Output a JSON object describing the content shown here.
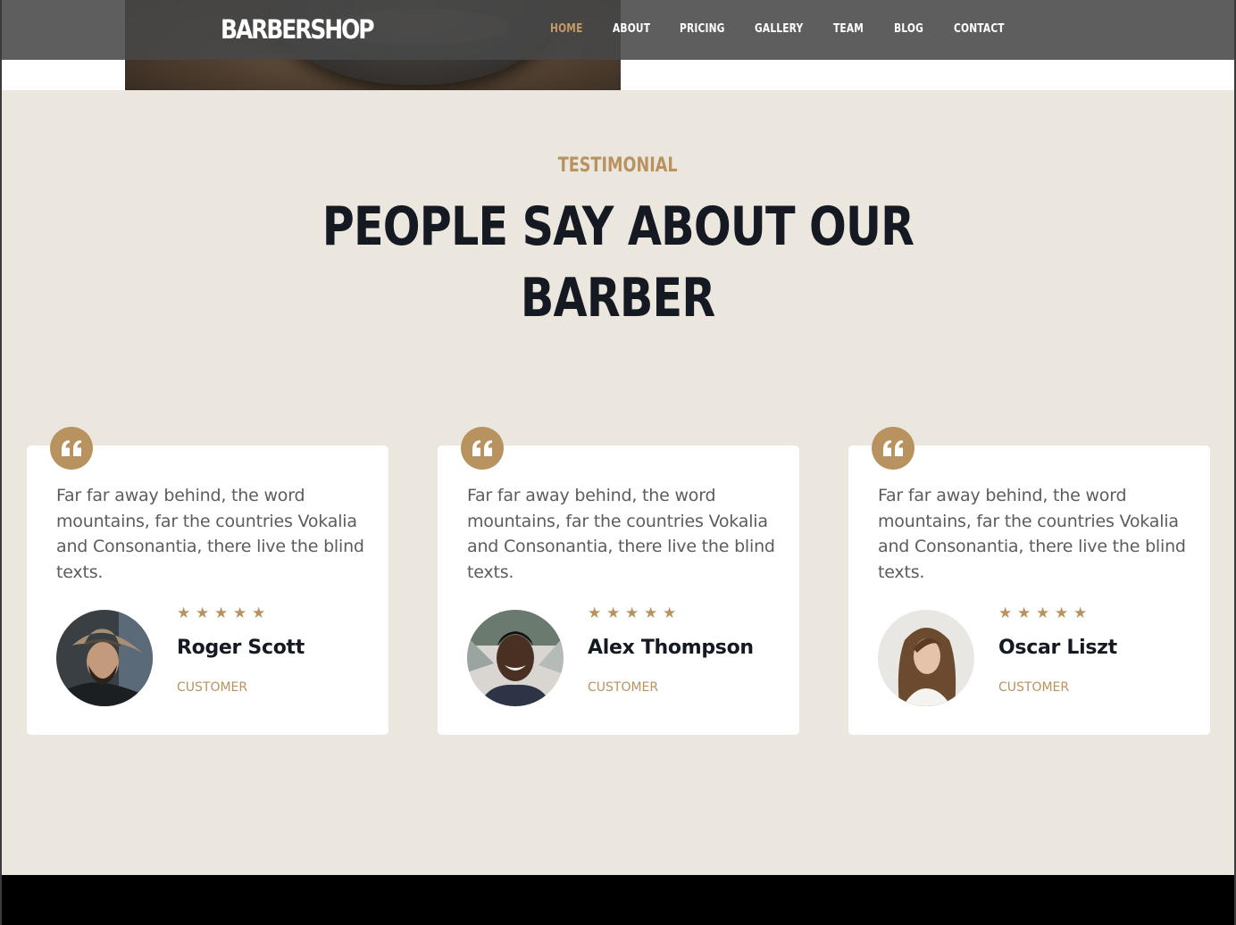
{
  "brand": "BARBERSHOP",
  "nav": [
    {
      "label": "HOME",
      "active": true
    },
    {
      "label": "ABOUT",
      "active": false
    },
    {
      "label": "PRICING",
      "active": false
    },
    {
      "label": "GALLERY",
      "active": false
    },
    {
      "label": "TEAM",
      "active": false
    },
    {
      "label": "BLOG",
      "active": false
    },
    {
      "label": "CONTACT",
      "active": false
    }
  ],
  "testimonial": {
    "eyebrow": "TESTIMONIAL",
    "headline_line1": "PEOPLE SAY ABOUT OUR",
    "headline_line2": "BARBER",
    "cards": [
      {
        "quote": "Far far away behind, the word mountains, far the countries Vokalia and Consonantia, there live the blind texts.",
        "rating": 5,
        "name": "Roger Scott",
        "role": "CUSTOMER",
        "avatar": "man-with-hat-photo"
      },
      {
        "quote": "Far far away behind, the word mountains, far the countries Vokalia and Consonantia, there live the blind texts.",
        "rating": 5,
        "name": "Alex Thompson",
        "role": "CUSTOMER",
        "avatar": "smiling-man-photo"
      },
      {
        "quote": "Far far away behind, the word mountains, far the countries Vokalia and Consonantia, there live the blind texts.",
        "rating": 5,
        "name": "Oscar Liszt",
        "role": "CUSTOMER",
        "avatar": "long-hair-person-photo"
      }
    ]
  },
  "colors": {
    "accent": "#b8935f",
    "section_bg": "#ebe7df",
    "heading": "#151a22",
    "navbar": "#484848"
  },
  "icons": {
    "quote": "quote-icon",
    "star": "star-icon"
  }
}
